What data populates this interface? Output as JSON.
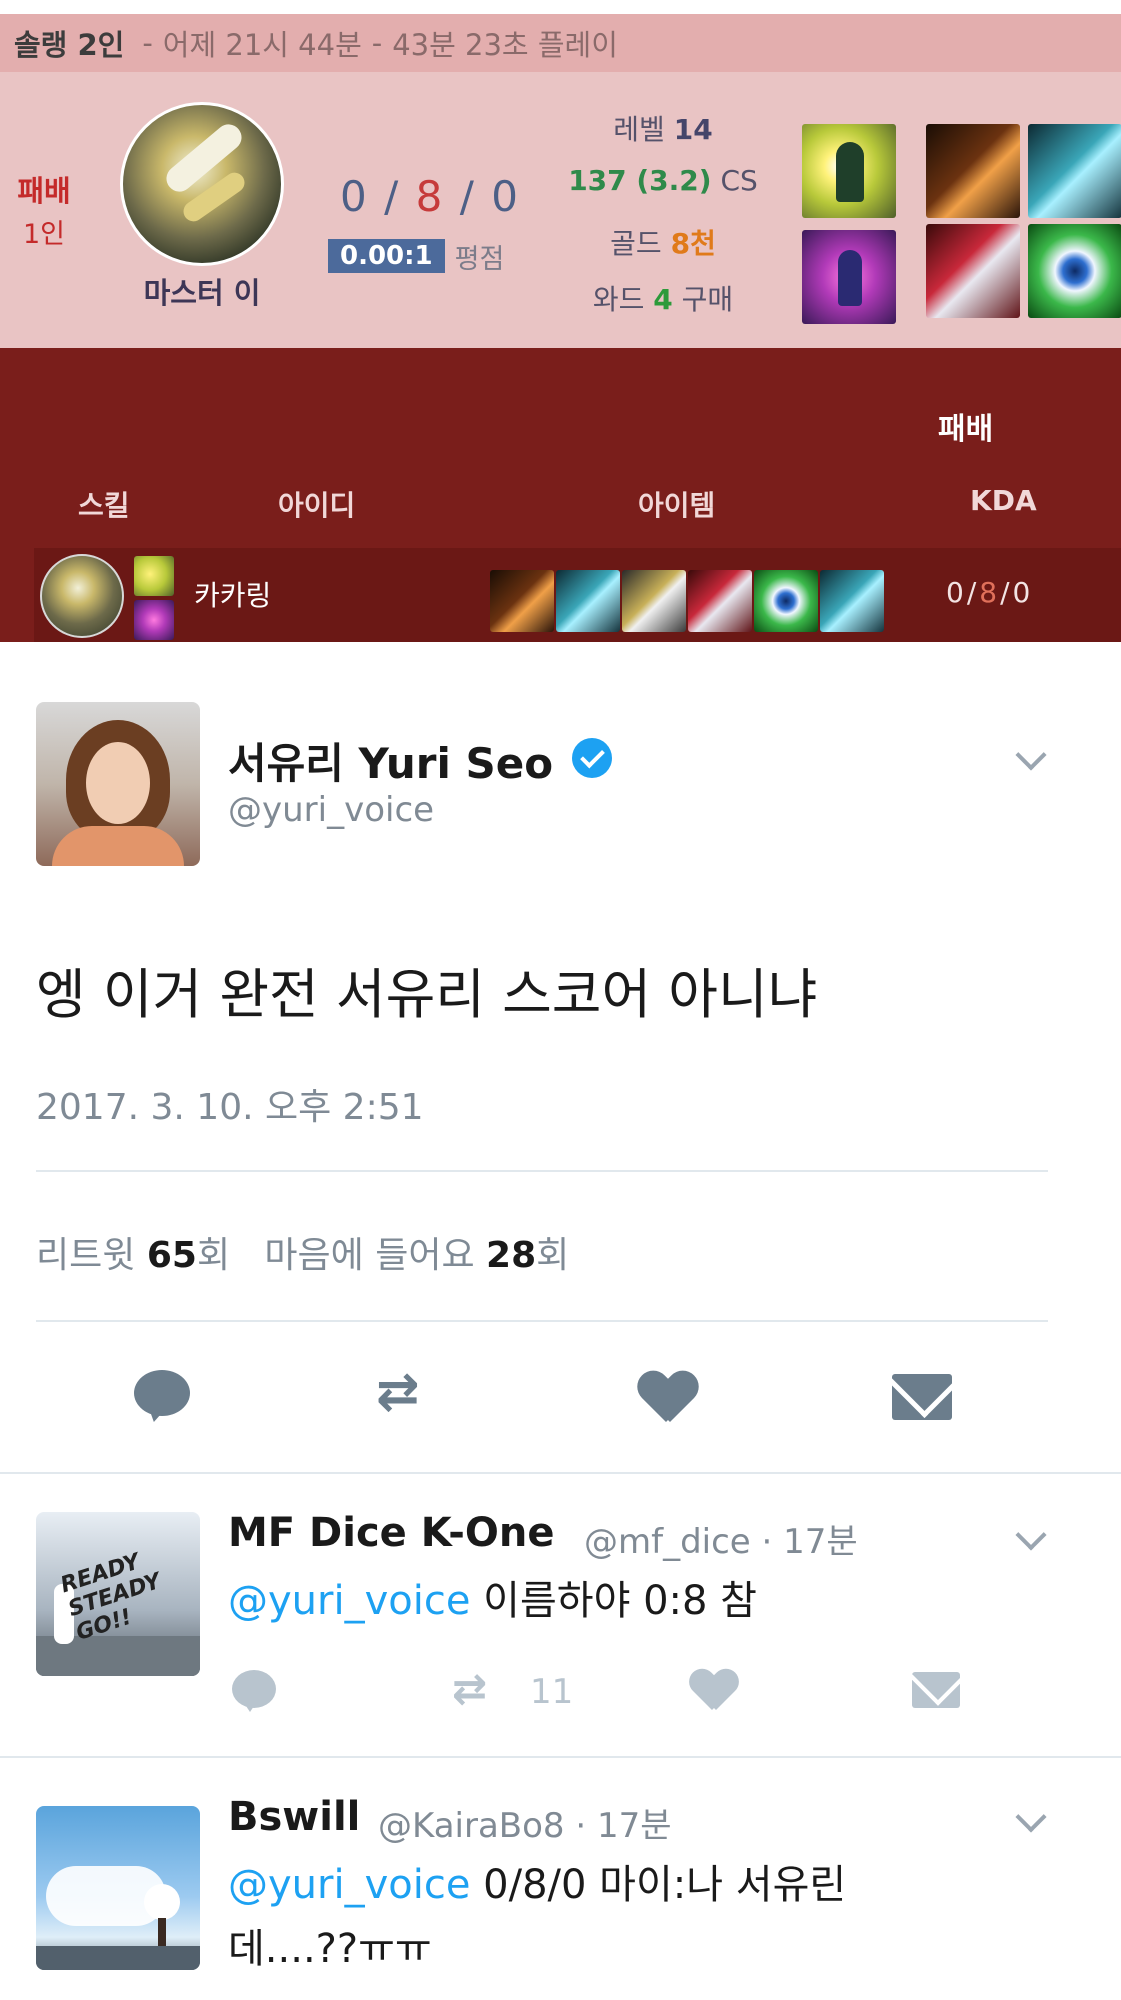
{
  "game": {
    "header": {
      "queue": "솔랭 2인",
      "date": "어제 21시 44분",
      "duration": "43분 23초 플레이"
    },
    "result_main": "패배",
    "result_sub": "1인",
    "champion": "마스터 이",
    "kda": {
      "kills": "0",
      "deaths": "8",
      "assists": "0",
      "sep": "/"
    },
    "ratio_value": "0.00:1",
    "ratio_label": "평점",
    "level_label": "레벨",
    "level_value": "14",
    "cs_value": "137 (3.2)",
    "cs_unit": "CS",
    "gold_label": "골드",
    "gold_value": "8천",
    "ward_label": "와드",
    "ward_value": "4",
    "ward_unit": "구매",
    "table": {
      "result_tag": "패배",
      "headers": [
        "스킬",
        "아이디",
        "아이템",
        "KDA"
      ],
      "row": {
        "player": "카카링",
        "kda_k": "0",
        "kda_d": "8",
        "kda_a": "0",
        "sep": "/"
      }
    }
  },
  "tweet": {
    "name": "서유리 Yuri Seo",
    "handle": "@yuri_voice",
    "verified": true,
    "text": "엥 이거 완전 서유리 스코어 아니냐",
    "time": "2017. 3. 10. 오후 2:51",
    "retweet_label": "리트윗",
    "retweet_count": "65",
    "like_label": "마음에 들어요",
    "like_count": "28",
    "count_suffix": "회"
  },
  "replies": [
    {
      "name": "MF Dice K-One",
      "meta": "@mf_dice · 17분",
      "mention": "@yuri_voice",
      "text": " 이름하야 0:8 참",
      "retweets": "11",
      "avatar_text": "READY STEADY GO!!"
    },
    {
      "name": "Bswill",
      "meta": "@KairaBo8 · 17분",
      "mention": "@yuri_voice",
      "text": " 0/8/0 마이:나 서유린",
      "text_line2": "데....??ㅠㅠ"
    }
  ],
  "colors": {
    "summary_bg": "#e9c4c4",
    "table_bg": "#7a1e1b",
    "twitter_blue": "#1da1f2",
    "defeat_red": "#c42a2a"
  }
}
